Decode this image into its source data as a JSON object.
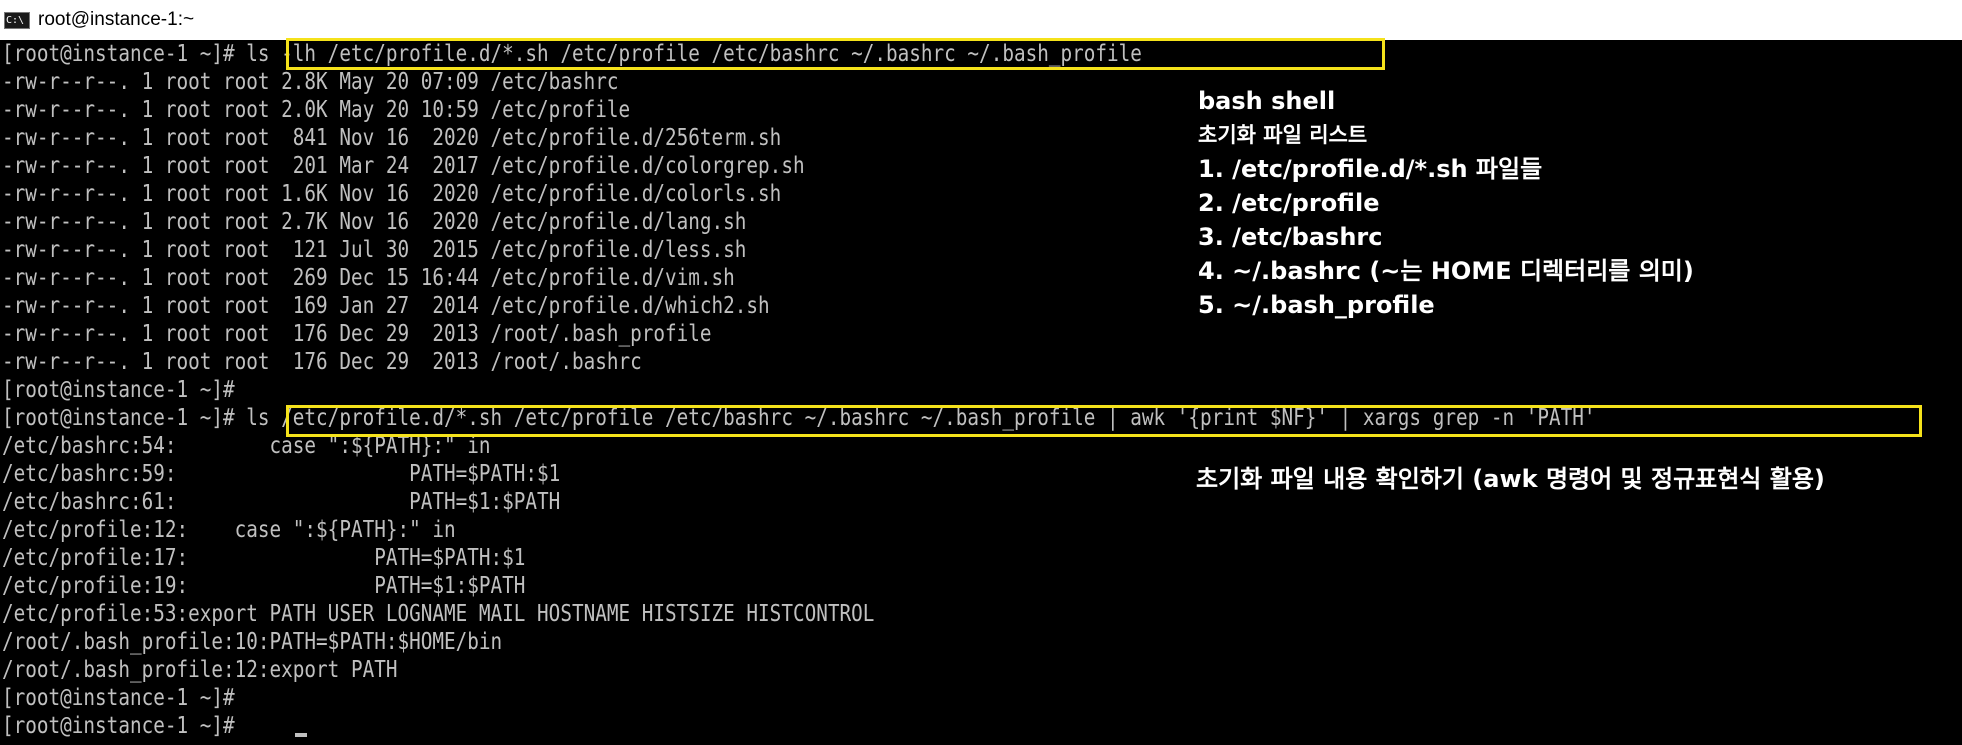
{
  "window": {
    "title": "root@instance-1:~",
    "icon": "terminal-icon",
    "icon_text": "C:\\"
  },
  "terminal": {
    "lines": [
      "[root@instance-1 ~]# ls -lh /etc/profile.d/*.sh /etc/profile /etc/bashrc ~/.bashrc ~/.bash_profile",
      "-rw-r--r--. 1 root root 2.8K May 20 07:09 /etc/bashrc",
      "-rw-r--r--. 1 root root 2.0K May 20 10:59 /etc/profile",
      "-rw-r--r--. 1 root root  841 Nov 16  2020 /etc/profile.d/256term.sh",
      "-rw-r--r--. 1 root root  201 Mar 24  2017 /etc/profile.d/colorgrep.sh",
      "-rw-r--r--. 1 root root 1.6K Nov 16  2020 /etc/profile.d/colorls.sh",
      "-rw-r--r--. 1 root root 2.7K Nov 16  2020 /etc/profile.d/lang.sh",
      "-rw-r--r--. 1 root root  121 Jul 30  2015 /etc/profile.d/less.sh",
      "-rw-r--r--. 1 root root  269 Dec 15 16:44 /etc/profile.d/vim.sh",
      "-rw-r--r--. 1 root root  169 Jan 27  2014 /etc/profile.d/which2.sh",
      "-rw-r--r--. 1 root root  176 Dec 29  2013 /root/.bash_profile",
      "-rw-r--r--. 1 root root  176 Dec 29  2013 /root/.bashrc",
      "[root@instance-1 ~]#",
      "[root@instance-1 ~]# ls /etc/profile.d/*.sh /etc/profile /etc/bashrc ~/.bashrc ~/.bash_profile | awk '{print $NF}' | xargs grep -n 'PATH'",
      "/etc/bashrc:54:        case \":${PATH}:\" in",
      "/etc/bashrc:59:                    PATH=$PATH:$1",
      "/etc/bashrc:61:                    PATH=$1:$PATH",
      "/etc/profile:12:    case \":${PATH}:\" in",
      "/etc/profile:17:                PATH=$PATH:$1",
      "/etc/profile:19:                PATH=$1:$PATH",
      "/etc/profile:53:export PATH USER LOGNAME MAIL HOSTNAME HISTSIZE HISTCONTROL",
      "/root/.bash_profile:10:PATH=$PATH:$HOME/bin",
      "/root/.bash_profile:12:export PATH",
      "[root@instance-1 ~]#",
      "[root@instance-1 ~]#"
    ]
  },
  "annotations": {
    "list_block": [
      "bash shell",
      "초기화 파일 리스트",
      "1. /etc/profile.d/*.sh 파일들",
      "2. /etc/profile",
      "3. /etc/bashrc",
      "4. ~/.bashrc (~는 HOME 디렉터리를 의미)",
      "5. ~/.bash_profile"
    ],
    "content_note": "초기화 파일 내용 확인하기 (awk 명령어 및 정규표현식 활용)"
  },
  "colors": {
    "terminal_bg": "#000000",
    "terminal_fg": "#c0c0c0",
    "highlight": "#f5e21b",
    "annotation": "#ffffff"
  }
}
